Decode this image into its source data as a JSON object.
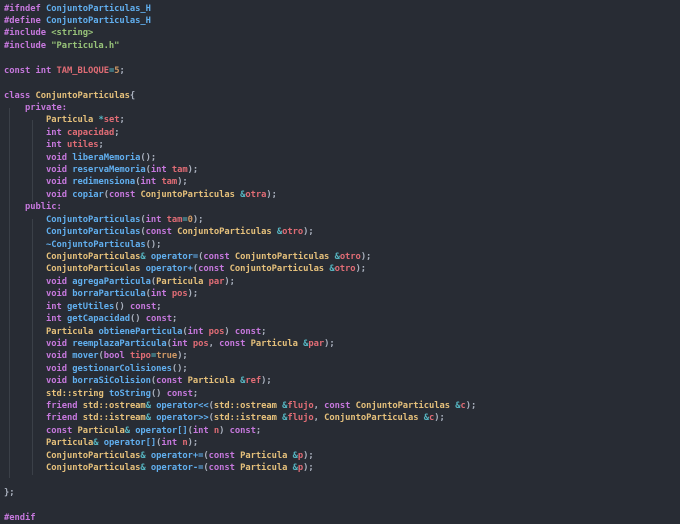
{
  "colors": {
    "background": "#282c34",
    "indent_guide": "#3b4048",
    "plain": "#abb2bf",
    "keyword": "#c678dd",
    "type": "#e5c07b",
    "function": "#61afef",
    "string": "#98c379",
    "number": "#d19a66",
    "parameter": "#e06c75",
    "macro": "#61afef",
    "operator": "#56b6c2"
  },
  "code_lines": [
    [
      {
        "t": "#ifndef ",
        "c": "keyword"
      },
      {
        "t": "ConjuntoParticulas_H",
        "c": "macro"
      }
    ],
    [
      {
        "t": "#define ",
        "c": "keyword"
      },
      {
        "t": "ConjuntoParticulas_H",
        "c": "macro"
      }
    ],
    [
      {
        "t": "#include ",
        "c": "keyword"
      },
      {
        "t": "<string>",
        "c": "string"
      }
    ],
    [
      {
        "t": "#include ",
        "c": "keyword"
      },
      {
        "t": "\"Particula.h\"",
        "c": "string"
      }
    ],
    [],
    [
      {
        "t": "const ",
        "c": "keyword"
      },
      {
        "t": "int ",
        "c": "keyword"
      },
      {
        "t": "TAM_BLOQUE",
        "c": "parameter"
      },
      {
        "t": "=",
        "c": "operator"
      },
      {
        "t": "5",
        "c": "number"
      },
      {
        "t": ";",
        "c": "plain"
      }
    ],
    [],
    [
      {
        "t": "class ",
        "c": "keyword"
      },
      {
        "t": "ConjuntoParticulas",
        "c": "type"
      },
      {
        "t": "{",
        "c": "plain"
      }
    ],
    [
      {
        "t": "    private:",
        "c": "keyword"
      }
    ],
    [
      {
        "t": "        ",
        "c": "plain"
      },
      {
        "t": "Particula ",
        "c": "type"
      },
      {
        "t": "*",
        "c": "operator"
      },
      {
        "t": "set",
        "c": "parameter"
      },
      {
        "t": ";",
        "c": "plain"
      }
    ],
    [
      {
        "t": "        ",
        "c": "plain"
      },
      {
        "t": "int ",
        "c": "keyword"
      },
      {
        "t": "capacidad",
        "c": "parameter"
      },
      {
        "t": ";",
        "c": "plain"
      }
    ],
    [
      {
        "t": "        ",
        "c": "plain"
      },
      {
        "t": "int ",
        "c": "keyword"
      },
      {
        "t": "utiles",
        "c": "parameter"
      },
      {
        "t": ";",
        "c": "plain"
      }
    ],
    [
      {
        "t": "        ",
        "c": "plain"
      },
      {
        "t": "void ",
        "c": "keyword"
      },
      {
        "t": "liberaMemoria",
        "c": "function"
      },
      {
        "t": "();",
        "c": "plain"
      }
    ],
    [
      {
        "t": "        ",
        "c": "plain"
      },
      {
        "t": "void ",
        "c": "keyword"
      },
      {
        "t": "reservaMemoria",
        "c": "function"
      },
      {
        "t": "(",
        "c": "plain"
      },
      {
        "t": "int ",
        "c": "keyword"
      },
      {
        "t": "tam",
        "c": "parameter"
      },
      {
        "t": ");",
        "c": "plain"
      }
    ],
    [
      {
        "t": "        ",
        "c": "plain"
      },
      {
        "t": "void ",
        "c": "keyword"
      },
      {
        "t": "redimensiona",
        "c": "function"
      },
      {
        "t": "(",
        "c": "plain"
      },
      {
        "t": "int ",
        "c": "keyword"
      },
      {
        "t": "tam",
        "c": "parameter"
      },
      {
        "t": ");",
        "c": "plain"
      }
    ],
    [
      {
        "t": "        ",
        "c": "plain"
      },
      {
        "t": "void ",
        "c": "keyword"
      },
      {
        "t": "copiar",
        "c": "function"
      },
      {
        "t": "(",
        "c": "plain"
      },
      {
        "t": "const ",
        "c": "keyword"
      },
      {
        "t": "ConjuntoParticulas ",
        "c": "type"
      },
      {
        "t": "&",
        "c": "operator"
      },
      {
        "t": "otra",
        "c": "parameter"
      },
      {
        "t": ");",
        "c": "plain"
      }
    ],
    [
      {
        "t": "    public:",
        "c": "keyword"
      }
    ],
    [
      {
        "t": "        ",
        "c": "plain"
      },
      {
        "t": "ConjuntoParticulas",
        "c": "function"
      },
      {
        "t": "(",
        "c": "plain"
      },
      {
        "t": "int ",
        "c": "keyword"
      },
      {
        "t": "tam",
        "c": "parameter"
      },
      {
        "t": "=",
        "c": "operator"
      },
      {
        "t": "0",
        "c": "number"
      },
      {
        "t": ");",
        "c": "plain"
      }
    ],
    [
      {
        "t": "        ",
        "c": "plain"
      },
      {
        "t": "ConjuntoParticulas",
        "c": "function"
      },
      {
        "t": "(",
        "c": "plain"
      },
      {
        "t": "const ",
        "c": "keyword"
      },
      {
        "t": "ConjuntoParticulas ",
        "c": "type"
      },
      {
        "t": "&",
        "c": "operator"
      },
      {
        "t": "otro",
        "c": "parameter"
      },
      {
        "t": ");",
        "c": "plain"
      }
    ],
    [
      {
        "t": "        ",
        "c": "plain"
      },
      {
        "t": "~ConjuntoParticulas",
        "c": "function"
      },
      {
        "t": "();",
        "c": "plain"
      }
    ],
    [
      {
        "t": "        ",
        "c": "plain"
      },
      {
        "t": "ConjuntoParticulas",
        "c": "type"
      },
      {
        "t": "& ",
        "c": "operator"
      },
      {
        "t": "operator=",
        "c": "function"
      },
      {
        "t": "(",
        "c": "plain"
      },
      {
        "t": "const ",
        "c": "keyword"
      },
      {
        "t": "ConjuntoParticulas ",
        "c": "type"
      },
      {
        "t": "&",
        "c": "operator"
      },
      {
        "t": "otro",
        "c": "parameter"
      },
      {
        "t": ");",
        "c": "plain"
      }
    ],
    [
      {
        "t": "        ",
        "c": "plain"
      },
      {
        "t": "ConjuntoParticulas ",
        "c": "type"
      },
      {
        "t": "operator+",
        "c": "function"
      },
      {
        "t": "(",
        "c": "plain"
      },
      {
        "t": "const ",
        "c": "keyword"
      },
      {
        "t": "ConjuntoParticulas ",
        "c": "type"
      },
      {
        "t": "&",
        "c": "operator"
      },
      {
        "t": "otro",
        "c": "parameter"
      },
      {
        "t": ");",
        "c": "plain"
      }
    ],
    [
      {
        "t": "        ",
        "c": "plain"
      },
      {
        "t": "void ",
        "c": "keyword"
      },
      {
        "t": "agregaParticula",
        "c": "function"
      },
      {
        "t": "(",
        "c": "plain"
      },
      {
        "t": "Particula ",
        "c": "type"
      },
      {
        "t": "par",
        "c": "parameter"
      },
      {
        "t": ");",
        "c": "plain"
      }
    ],
    [
      {
        "t": "        ",
        "c": "plain"
      },
      {
        "t": "void ",
        "c": "keyword"
      },
      {
        "t": "borraParticula",
        "c": "function"
      },
      {
        "t": "(",
        "c": "plain"
      },
      {
        "t": "int ",
        "c": "keyword"
      },
      {
        "t": "pos",
        "c": "parameter"
      },
      {
        "t": ");",
        "c": "plain"
      }
    ],
    [
      {
        "t": "        ",
        "c": "plain"
      },
      {
        "t": "int ",
        "c": "keyword"
      },
      {
        "t": "getUtiles",
        "c": "function"
      },
      {
        "t": "() ",
        "c": "plain"
      },
      {
        "t": "const",
        "c": "keyword"
      },
      {
        "t": ";",
        "c": "plain"
      }
    ],
    [
      {
        "t": "        ",
        "c": "plain"
      },
      {
        "t": "int ",
        "c": "keyword"
      },
      {
        "t": "getCapacidad",
        "c": "function"
      },
      {
        "t": "() ",
        "c": "plain"
      },
      {
        "t": "const",
        "c": "keyword"
      },
      {
        "t": ";",
        "c": "plain"
      }
    ],
    [
      {
        "t": "        ",
        "c": "plain"
      },
      {
        "t": "Particula ",
        "c": "type"
      },
      {
        "t": "obtieneParticula",
        "c": "function"
      },
      {
        "t": "(",
        "c": "plain"
      },
      {
        "t": "int ",
        "c": "keyword"
      },
      {
        "t": "pos",
        "c": "parameter"
      },
      {
        "t": ") ",
        "c": "plain"
      },
      {
        "t": "const",
        "c": "keyword"
      },
      {
        "t": ";",
        "c": "plain"
      }
    ],
    [
      {
        "t": "        ",
        "c": "plain"
      },
      {
        "t": "void ",
        "c": "keyword"
      },
      {
        "t": "reemplazaParticula",
        "c": "function"
      },
      {
        "t": "(",
        "c": "plain"
      },
      {
        "t": "int ",
        "c": "keyword"
      },
      {
        "t": "pos",
        "c": "parameter"
      },
      {
        "t": ", ",
        "c": "plain"
      },
      {
        "t": "const ",
        "c": "keyword"
      },
      {
        "t": "Particula ",
        "c": "type"
      },
      {
        "t": "&",
        "c": "operator"
      },
      {
        "t": "par",
        "c": "parameter"
      },
      {
        "t": ");",
        "c": "plain"
      }
    ],
    [
      {
        "t": "        ",
        "c": "plain"
      },
      {
        "t": "void ",
        "c": "keyword"
      },
      {
        "t": "mover",
        "c": "function"
      },
      {
        "t": "(",
        "c": "plain"
      },
      {
        "t": "bool ",
        "c": "keyword"
      },
      {
        "t": "tipo",
        "c": "parameter"
      },
      {
        "t": "=",
        "c": "operator"
      },
      {
        "t": "true",
        "c": "number"
      },
      {
        "t": ");",
        "c": "plain"
      }
    ],
    [
      {
        "t": "        ",
        "c": "plain"
      },
      {
        "t": "void ",
        "c": "keyword"
      },
      {
        "t": "gestionarColisiones",
        "c": "function"
      },
      {
        "t": "();",
        "c": "plain"
      }
    ],
    [
      {
        "t": "        ",
        "c": "plain"
      },
      {
        "t": "void ",
        "c": "keyword"
      },
      {
        "t": "borraSiColision",
        "c": "function"
      },
      {
        "t": "(",
        "c": "plain"
      },
      {
        "t": "const ",
        "c": "keyword"
      },
      {
        "t": "Particula ",
        "c": "type"
      },
      {
        "t": "&",
        "c": "operator"
      },
      {
        "t": "ref",
        "c": "parameter"
      },
      {
        "t": ");",
        "c": "plain"
      }
    ],
    [
      {
        "t": "        ",
        "c": "plain"
      },
      {
        "t": "std::",
        "c": "type"
      },
      {
        "t": "string ",
        "c": "type"
      },
      {
        "t": "toString",
        "c": "function"
      },
      {
        "t": "() ",
        "c": "plain"
      },
      {
        "t": "const",
        "c": "keyword"
      },
      {
        "t": ";",
        "c": "plain"
      }
    ],
    [
      {
        "t": "        ",
        "c": "plain"
      },
      {
        "t": "friend ",
        "c": "keyword"
      },
      {
        "t": "std::",
        "c": "type"
      },
      {
        "t": "ostream",
        "c": "type"
      },
      {
        "t": "& ",
        "c": "operator"
      },
      {
        "t": "operator<<",
        "c": "function"
      },
      {
        "t": "(",
        "c": "plain"
      },
      {
        "t": "std::",
        "c": "type"
      },
      {
        "t": "ostream ",
        "c": "type"
      },
      {
        "t": "&",
        "c": "operator"
      },
      {
        "t": "flujo",
        "c": "parameter"
      },
      {
        "t": ", ",
        "c": "plain"
      },
      {
        "t": "const ",
        "c": "keyword"
      },
      {
        "t": "ConjuntoParticulas ",
        "c": "type"
      },
      {
        "t": "&",
        "c": "operator"
      },
      {
        "t": "c",
        "c": "parameter"
      },
      {
        "t": ");",
        "c": "plain"
      }
    ],
    [
      {
        "t": "        ",
        "c": "plain"
      },
      {
        "t": "friend ",
        "c": "keyword"
      },
      {
        "t": "std::",
        "c": "type"
      },
      {
        "t": "istream",
        "c": "type"
      },
      {
        "t": "& ",
        "c": "operator"
      },
      {
        "t": "operator>>",
        "c": "function"
      },
      {
        "t": "(",
        "c": "plain"
      },
      {
        "t": "std::",
        "c": "type"
      },
      {
        "t": "istream ",
        "c": "type"
      },
      {
        "t": "&",
        "c": "operator"
      },
      {
        "t": "flujo",
        "c": "parameter"
      },
      {
        "t": ", ",
        "c": "plain"
      },
      {
        "t": "ConjuntoParticulas ",
        "c": "type"
      },
      {
        "t": "&",
        "c": "operator"
      },
      {
        "t": "c",
        "c": "parameter"
      },
      {
        "t": ");",
        "c": "plain"
      }
    ],
    [
      {
        "t": "        ",
        "c": "plain"
      },
      {
        "t": "const ",
        "c": "keyword"
      },
      {
        "t": "Particula",
        "c": "type"
      },
      {
        "t": "& ",
        "c": "operator"
      },
      {
        "t": "operator[]",
        "c": "function"
      },
      {
        "t": "(",
        "c": "plain"
      },
      {
        "t": "int ",
        "c": "keyword"
      },
      {
        "t": "n",
        "c": "parameter"
      },
      {
        "t": ") ",
        "c": "plain"
      },
      {
        "t": "const",
        "c": "keyword"
      },
      {
        "t": ";",
        "c": "plain"
      }
    ],
    [
      {
        "t": "        ",
        "c": "plain"
      },
      {
        "t": "Particula",
        "c": "type"
      },
      {
        "t": "& ",
        "c": "operator"
      },
      {
        "t": "operator[]",
        "c": "function"
      },
      {
        "t": "(",
        "c": "plain"
      },
      {
        "t": "int ",
        "c": "keyword"
      },
      {
        "t": "n",
        "c": "parameter"
      },
      {
        "t": ");",
        "c": "plain"
      }
    ],
    [
      {
        "t": "        ",
        "c": "plain"
      },
      {
        "t": "ConjuntoParticulas",
        "c": "type"
      },
      {
        "t": "& ",
        "c": "operator"
      },
      {
        "t": "operator+=",
        "c": "function"
      },
      {
        "t": "(",
        "c": "plain"
      },
      {
        "t": "const ",
        "c": "keyword"
      },
      {
        "t": "Particula ",
        "c": "type"
      },
      {
        "t": "&",
        "c": "operator"
      },
      {
        "t": "p",
        "c": "parameter"
      },
      {
        "t": ");",
        "c": "plain"
      }
    ],
    [
      {
        "t": "        ",
        "c": "plain"
      },
      {
        "t": "ConjuntoParticulas",
        "c": "type"
      },
      {
        "t": "& ",
        "c": "operator"
      },
      {
        "t": "operator-=",
        "c": "function"
      },
      {
        "t": "(",
        "c": "plain"
      },
      {
        "t": "const ",
        "c": "keyword"
      },
      {
        "t": "Particula ",
        "c": "type"
      },
      {
        "t": "&",
        "c": "operator"
      },
      {
        "t": "p",
        "c": "parameter"
      },
      {
        "t": ");",
        "c": "plain"
      }
    ],
    [],
    [
      {
        "t": "};",
        "c": "plain"
      }
    ],
    [],
    [
      {
        "t": "#endif",
        "c": "keyword"
      }
    ]
  ]
}
